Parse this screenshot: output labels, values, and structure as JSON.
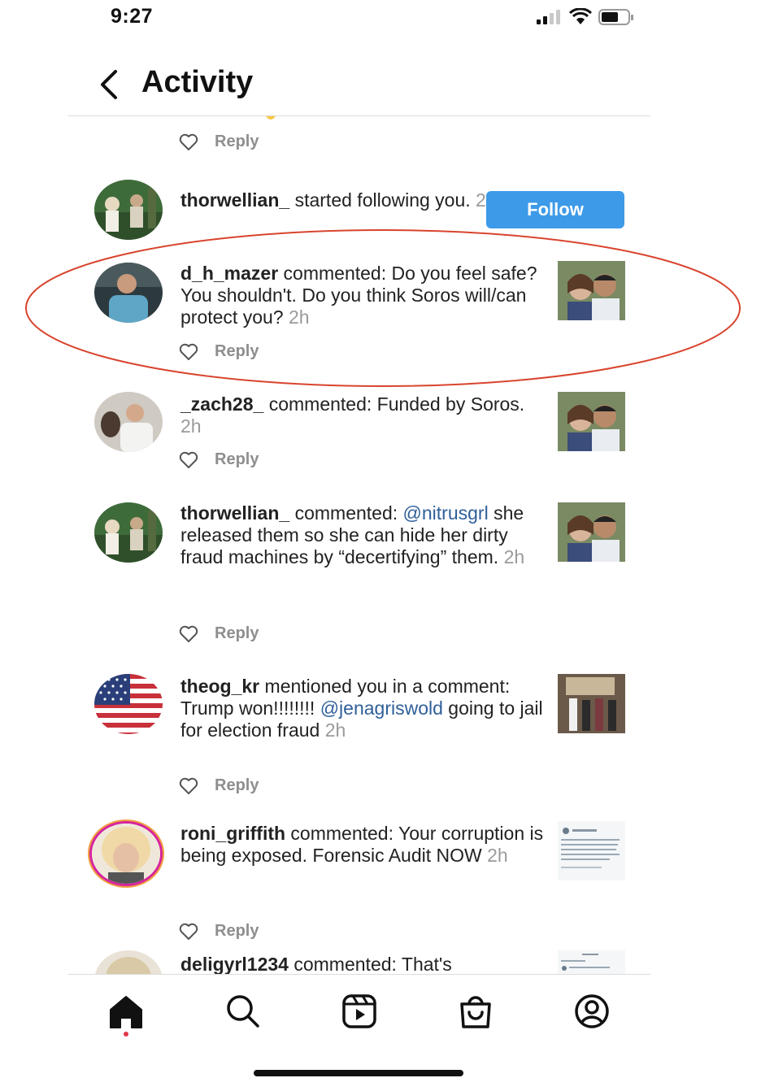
{
  "status_bar": {
    "time": "9:27"
  },
  "header": {
    "title": "Activity"
  },
  "top_partial": {
    "reply_label": "Reply"
  },
  "items": [
    {
      "username": "thorwellian_",
      "text": " started following you.",
      "time": "2h",
      "button_label": "Follow"
    },
    {
      "username": "d_h_mazer",
      "text": " commented: Do you feel safe? You shouldn't. Do you think Soros will/can protect you?",
      "time": "2h",
      "reply_label": "Reply"
    },
    {
      "username": "_zach28_",
      "text": " commented: Funded by Soros.",
      "time": "2h",
      "reply_label": "Reply"
    },
    {
      "username": "thorwellian_",
      "text_before": " commented: ",
      "mention": "@nitrusgrl",
      "text": " she released them so she can hide her dirty fraud machines by “decertifying” them.",
      "time": "2h",
      "reply_label": "Reply"
    },
    {
      "username": "theog_kr",
      "text_before": " mentioned you in a comment: Trump won!!!!!!!! ",
      "mention": "@jenagriswold",
      "text": " going to jail for election fraud",
      "time": "2h",
      "reply_label": "Reply"
    },
    {
      "username": "roni_griffith",
      "text": " commented: Your corruption is being exposed. Forensic Audit NOW",
      "time": "2h",
      "reply_label": "Reply"
    },
    {
      "username": "deligyrl1234",
      "text": " commented: That's"
    }
  ],
  "colors": {
    "follow_button": "#3d9ae8",
    "mention": "#2f5f9a",
    "highlight_ellipse": "#d9442e",
    "timestamp": "#9a9a9a"
  },
  "icons": {
    "tabs": [
      "home-icon",
      "search-icon",
      "reels-icon",
      "shop-icon",
      "profile-icon"
    ],
    "reply": "heart-outline-icon",
    "back": "chevron-left-icon"
  }
}
